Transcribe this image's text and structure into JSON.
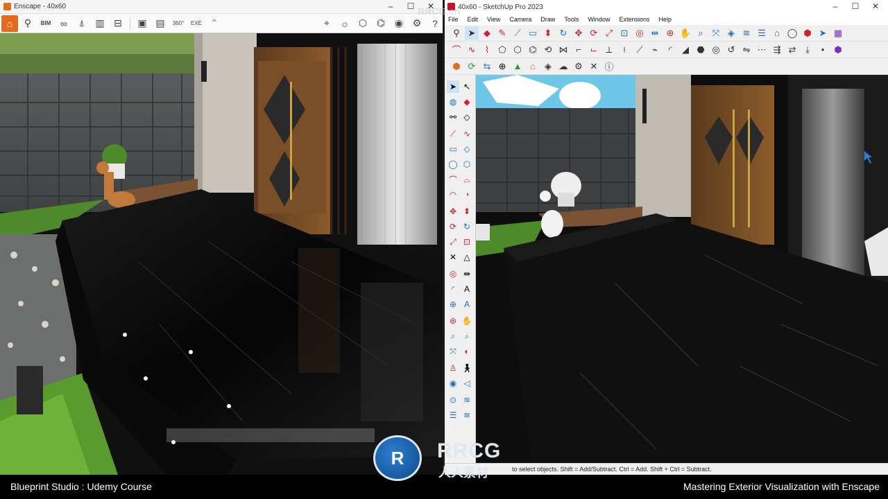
{
  "enscape": {
    "window_title": "Enscape - 40x60",
    "toolbar_icons": [
      "home-icon",
      "asset-library-icon",
      "bim-icon",
      "list-icon",
      "binoculars-icon",
      "shape-icon",
      "building-icon",
      "layers-icon",
      "stairs-icon",
      "render-image-icon",
      "render-batch-icon",
      "panorama-360-icon",
      "export-icon",
      "collapse-icon",
      "map-icon",
      "sun-icon",
      "cube-icon",
      "walk-icon",
      "eye-icon",
      "settings-icon",
      "help-icon"
    ]
  },
  "sketchup": {
    "window_title": "40x60 - SketchUp Pro 2023",
    "menu": [
      "File",
      "Edit",
      "View",
      "Camera",
      "Draw",
      "Tools",
      "Window",
      "Extensions",
      "Help"
    ],
    "status_text": "to select objects. Shift = Add/Subtract. Ctrl = Add. Shift + Ctrl = Subtract."
  },
  "caption": {
    "left": "Blueprint Studio : Udemy Course",
    "right": "Mastering Exterior Visualization with Enscape"
  },
  "watermark": {
    "brand": "RRCG",
    "sub": "人人素材",
    "top": "RRCG.cn"
  }
}
